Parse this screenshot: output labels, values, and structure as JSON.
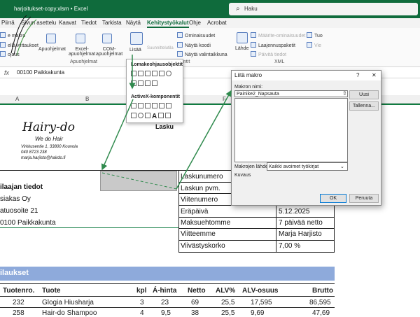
{
  "title": {
    "file": "harjoitukset-copy.xlsm • Excel",
    "search_placeholder": "Haku"
  },
  "menu": [
    "Piirrä",
    "Sivun asettelu",
    "Kaavat",
    "Tiedot",
    "Tarkista",
    "Näytä",
    "Kehitystyökalut",
    "Ohje",
    "Acrobat"
  ],
  "menu_active_index": 6,
  "ribbon": {
    "macros": "e makro",
    "relative": "ellä viittaukset",
    "security": "ojaus",
    "addins": "Apuohjelmat",
    "excel_addins": "Excel-\napuohjelmat",
    "com_addins": "COM-\napuohjelmat",
    "group_addins": "Apuohjelmat",
    "insert": "Lisää",
    "design_mode": "Suunnittelutila",
    "properties": "Ominaisuudet",
    "view_code": "Näytä koodi",
    "dialog": "Näytä valintaikkuna",
    "group_controls": "ntit",
    "source": "Lähde",
    "map_props": "Määrite-ominaisuudet",
    "expansion": "Laajennuspaketit",
    "refresh": "Päivitä tiedot",
    "import": "Tuo",
    "export": "Vie",
    "group_xml": "XML"
  },
  "formula_bar": {
    "fx": "fx",
    "value": "00100 Paikkakunta"
  },
  "columns": [
    "A",
    "B",
    "F"
  ],
  "dropdown": {
    "form_controls": "Lomakeohjausobjektit",
    "activex": "ActiveX-komponentit",
    "letter": "A"
  },
  "dialog": {
    "title": "Liitä makro",
    "help": "?",
    "close": "✕",
    "macro_name_label": "Makron nimi:",
    "macro_name_value": "Painike2_Napsauta",
    "new_button": "Uusi",
    "record_button": "Tallenna...",
    "macros_in_label": "Makrojen lähde:",
    "macros_in_value": "Kaikki avoimet työkirjat",
    "description_label": "Kuvaus",
    "ok": "OK",
    "cancel": "Peruuta"
  },
  "logo": {
    "brand": "Hairy-do",
    "tagline": "We do Hair",
    "address": "Virkkusentie 1, 33800 Kouvola",
    "phone": "040 8723 238",
    "email": "marja.harjisto@hairdo.fi"
  },
  "invoice": {
    "heading": "Lasku",
    "customer_heading": "ilaajan tiedot",
    "customer_name": "siakas Oy",
    "customer_address": "atuosoite 21",
    "customer_city": "0100 Paikkakunta",
    "fields": [
      {
        "label": "Laskunumero",
        "value": ""
      },
      {
        "label": "Laskun pvm.",
        "value": ""
      },
      {
        "label": "Viitenumero",
        "value": ""
      },
      {
        "label": "Eräpäivä",
        "value": "5.12.2025"
      },
      {
        "label": "Maksuehtomme",
        "value": "7 päivää netto"
      },
      {
        "label": "Viitteemme",
        "value": "Marja Harjisto"
      },
      {
        "label": "Viivästyskorko",
        "value": "7,00 %"
      }
    ]
  },
  "orders": {
    "heading": "ilaukset",
    "columns": [
      "Tuotenro.",
      "Tuote",
      "kpl",
      "Á-hinta",
      "Netto",
      "ALV%",
      "ALV-osuus",
      "Brutto"
    ],
    "rows": [
      [
        "232",
        "Glogia Hiusharja",
        "3",
        "23",
        "69",
        "25,5",
        "17,595",
        "86,595"
      ],
      [
        "258",
        "Hair-do Shampoo",
        "4",
        "9,5",
        "38",
        "25,5",
        "9,69",
        "47,69"
      ]
    ]
  }
}
